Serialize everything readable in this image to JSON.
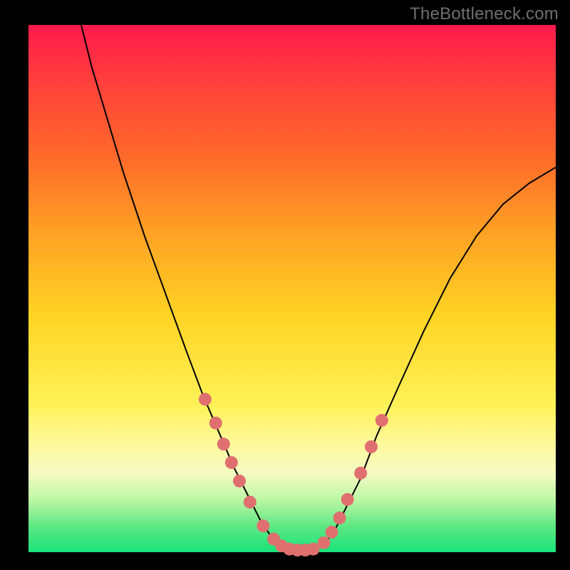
{
  "watermark": "TheBottleneck.com",
  "chart_data": {
    "type": "line",
    "title": "",
    "xlabel": "",
    "ylabel": "",
    "xlim": [
      0,
      100
    ],
    "ylim": [
      0,
      100
    ],
    "series": [
      {
        "name": "curve",
        "x": [
          10,
          12,
          15,
          18,
          22,
          26,
          30,
          33,
          36,
          39,
          42,
          44,
          46,
          47,
          48,
          49,
          50,
          52,
          54,
          56,
          58,
          60,
          63,
          66,
          70,
          75,
          80,
          85,
          90,
          95,
          100
        ],
        "y": [
          100,
          92,
          82,
          72,
          60,
          49,
          38,
          30,
          23,
          16,
          10,
          6,
          3,
          1.5,
          0.8,
          0.4,
          0.3,
          0.3,
          0.5,
          1.5,
          4,
          8,
          14,
          22,
          31,
          42,
          52,
          60,
          66,
          70,
          73
        ]
      }
    ],
    "markers": {
      "name": "markers",
      "color": "#e07070",
      "x": [
        33.5,
        35.5,
        37,
        38.5,
        40,
        42,
        44.5,
        46.5,
        48,
        49.5,
        51,
        52.5,
        54,
        56,
        57.5,
        59,
        60.5,
        63,
        65,
        67
      ],
      "y": [
        29,
        24.5,
        20.5,
        17,
        13.5,
        9.5,
        5,
        2.5,
        1.2,
        0.6,
        0.4,
        0.4,
        0.6,
        1.8,
        3.8,
        6.5,
        10,
        15,
        20,
        25
      ]
    },
    "background_gradient": {
      "direction": "vertical",
      "stops": [
        {
          "pos": 0.0,
          "color": "#ff1a4d"
        },
        {
          "pos": 0.25,
          "color": "#ff6a2a"
        },
        {
          "pos": 0.55,
          "color": "#ffd324"
        },
        {
          "pos": 0.8,
          "color": "#fdf9a0"
        },
        {
          "pos": 1.0,
          "color": "#18e37a"
        }
      ]
    }
  }
}
